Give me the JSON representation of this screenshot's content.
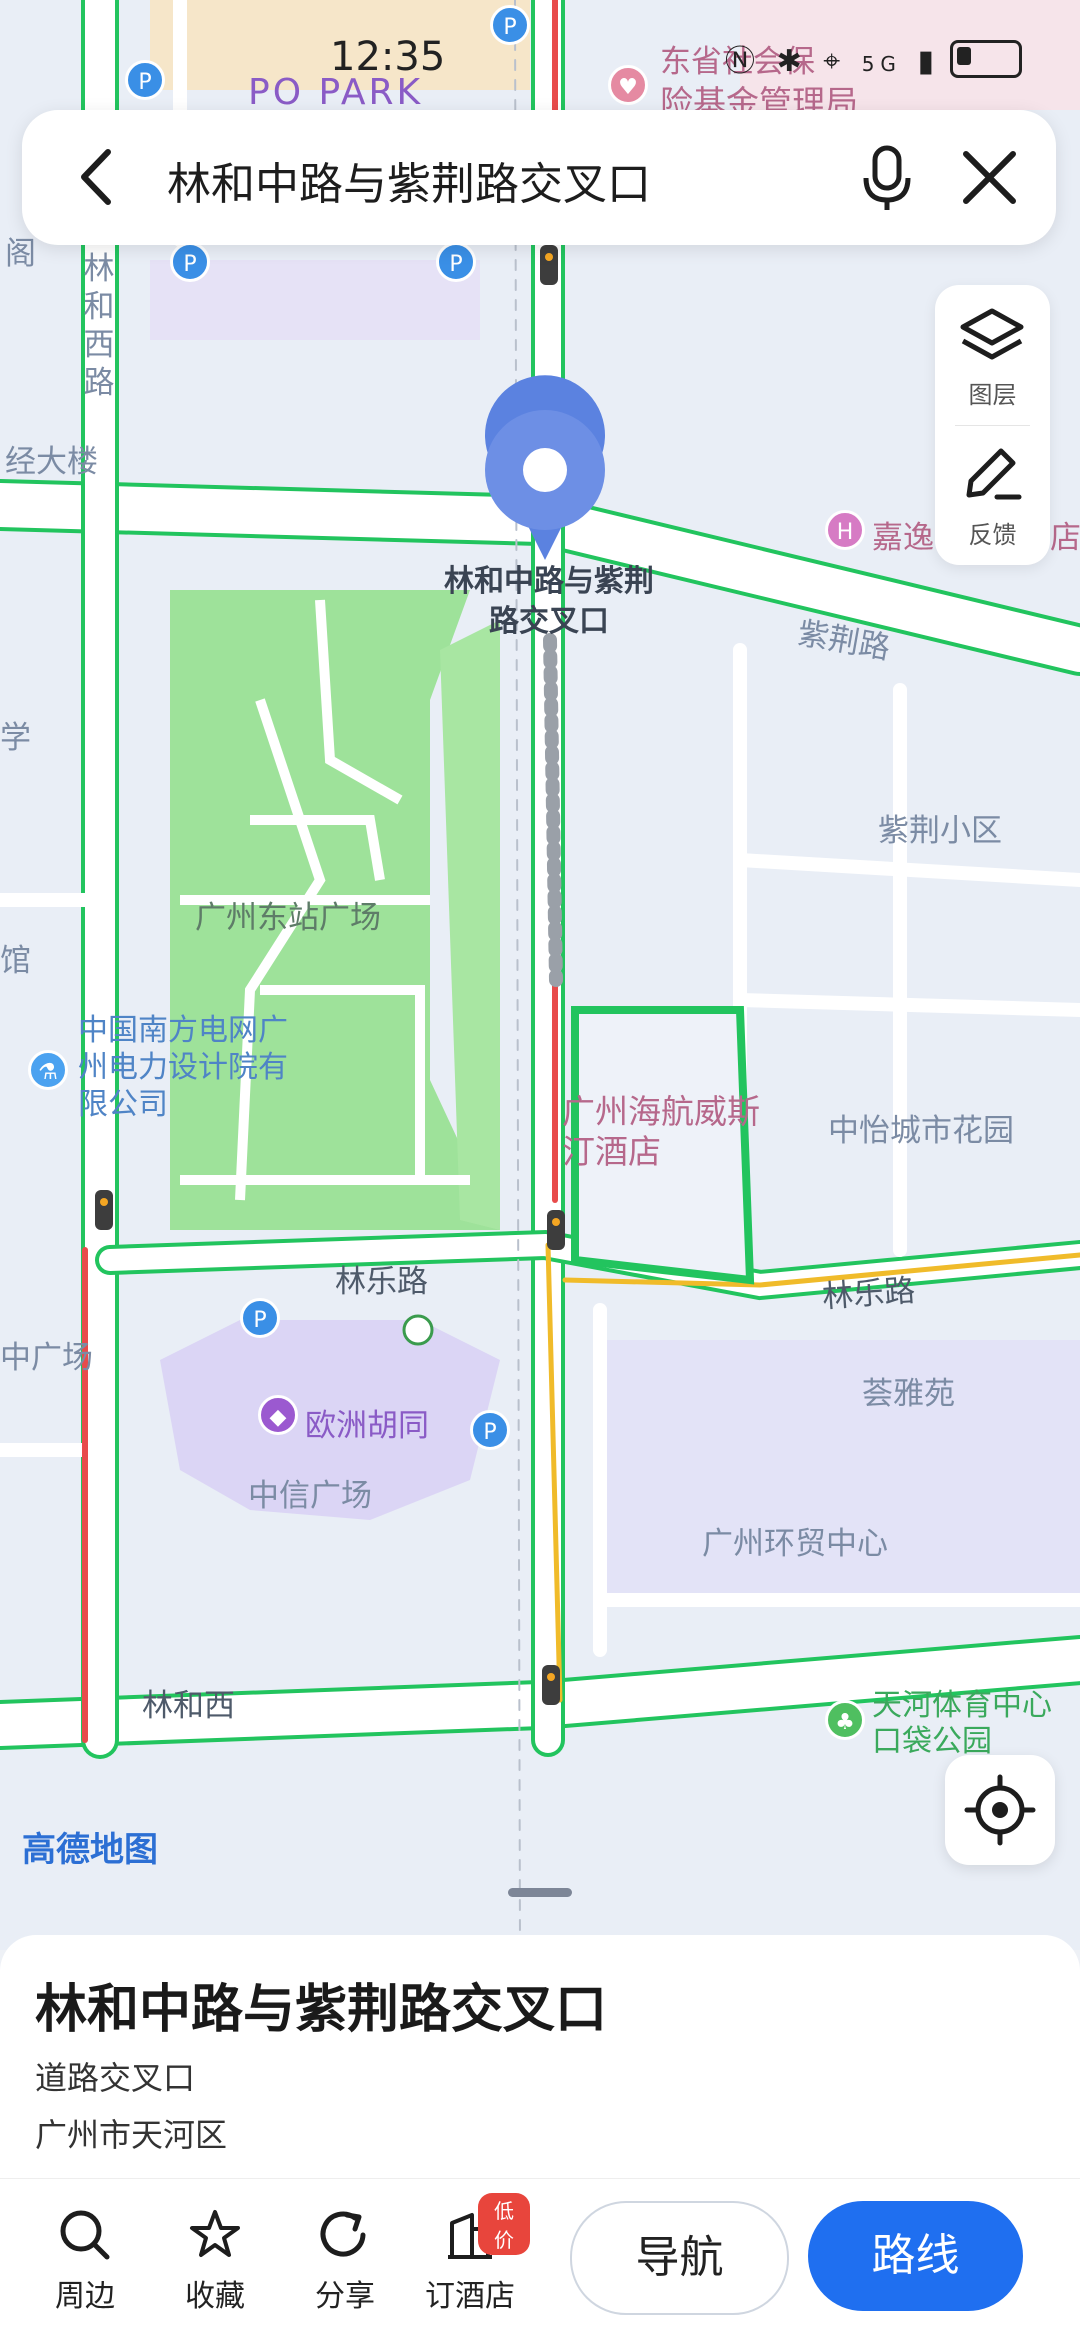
{
  "status_bar": {
    "time": "12:35",
    "network": "5G"
  },
  "search": {
    "query": "林和中路与紫荆路交叉口"
  },
  "side_panel": {
    "layers_label": "图层",
    "feedback_label": "反馈"
  },
  "map": {
    "pin_label": "林和中路与紫荆路交叉口",
    "labels": {
      "po_park": "PO PARK",
      "insurance": "险基金管理局",
      "insurance_top": "东省社会保",
      "linhe_west_road": "林和西路",
      "ge": "阁",
      "jing_building": "经大楼",
      "jiayi_hotel": "嘉逸",
      "dian": "店",
      "zijing_road": "紫荆路",
      "zijing_district": "紫荆小区",
      "east_station_square": "广州东站广场",
      "guan": "馆",
      "southern_grid": "中国南方电网广州电力设计院有限公司",
      "haihang": "广州海航威斯汀酒店",
      "zhongyi": "中怡城市花园",
      "linle_road_left": "林乐路",
      "linle_road_right": "林乐路",
      "zhong_plaza": "中广场",
      "huiyayuan": "荟雅苑",
      "ouzhou_hutong": "欧洲胡同",
      "citic_plaza": "中信广场",
      "huanmao": "广州环贸中心",
      "linhexi_station": "林和西",
      "tianhe_sports": "天河体育中心口袋公园",
      "xue": "学"
    },
    "brand": "高德地图"
  },
  "place": {
    "title": "林和中路与紫荆路交叉口",
    "type": "道路交叉口",
    "district": "广州市天河区"
  },
  "bottom_bar": {
    "nearby": "周边",
    "favorite": "收藏",
    "share": "分享",
    "hotel": "订酒店",
    "hotel_badge": "低价",
    "navigate": "导航",
    "route": "路线"
  }
}
